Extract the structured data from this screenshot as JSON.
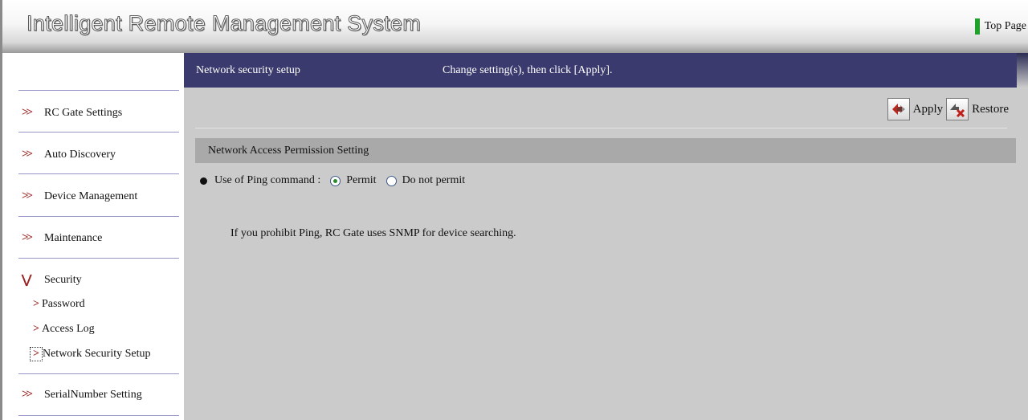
{
  "header": {
    "app_title": "Intelligent Remote Management System",
    "top_page_label": "Top Page"
  },
  "sidebar": {
    "items": [
      {
        "label": "RC Gate Settings"
      },
      {
        "label": "Auto Discovery"
      },
      {
        "label": "Device Management"
      },
      {
        "label": "Maintenance"
      },
      {
        "label": "Security"
      },
      {
        "label": "SerialNumber Setting"
      }
    ],
    "security_subitems": [
      {
        "label": "Password"
      },
      {
        "label": "Access Log"
      },
      {
        "label": "Network Security Setup"
      }
    ]
  },
  "main": {
    "page_title": "Network security setup",
    "instruction": "Change setting(s), then click [Apply].",
    "toolbar": {
      "apply_label": "Apply",
      "restore_label": "Restore"
    },
    "section_title": "Network Access Permission Setting",
    "ping": {
      "label": "Use of Ping command :",
      "options": [
        {
          "label": "Permit",
          "selected": true
        },
        {
          "label": "Do not permit",
          "selected": false
        }
      ]
    },
    "note": "If you prohibit Ping, RC Gate uses SNMP for device searching."
  },
  "colors": {
    "title_bar": "#3a3a6e",
    "main_bg": "#cbcbcb",
    "section_header": "#a9a9a9",
    "top_page_marker": "#1fa12b",
    "nav_icon": "#9b2222",
    "nav_separator": "#9595c8"
  },
  "icons": {
    "nav_collapsed": "double-chevron-right-icon",
    "nav_expanded": "double-chevron-down-icon",
    "sub_item": "chevron-right-icon",
    "apply": "apply-arrows-icon",
    "restore": "restore-x-icon"
  }
}
